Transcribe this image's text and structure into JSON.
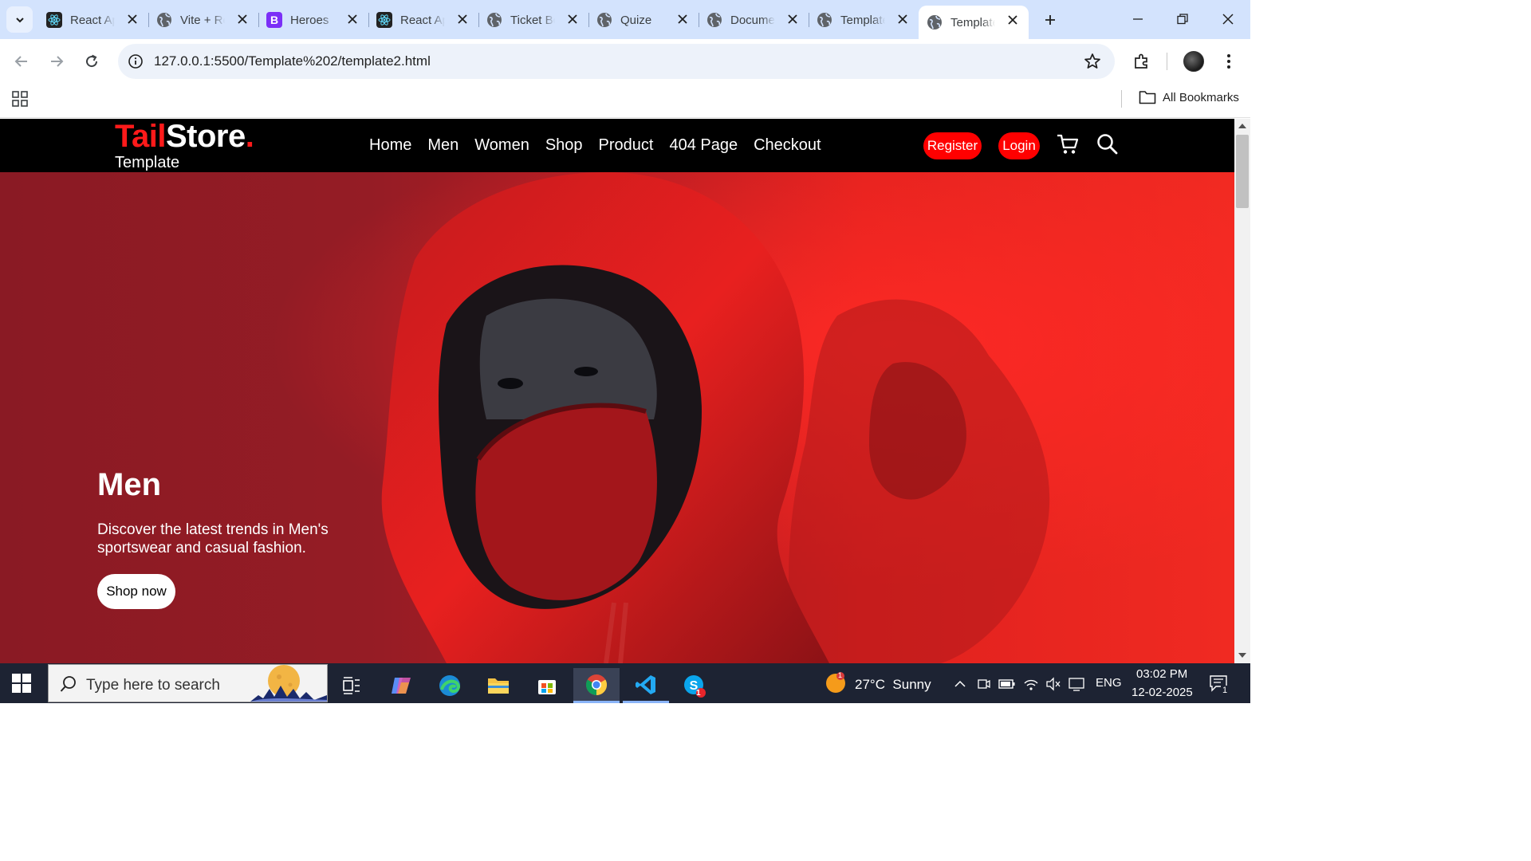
{
  "browser": {
    "tabs": [
      {
        "title": "React App",
        "favicon": "react-icon"
      },
      {
        "title": "Vite + React",
        "favicon": "globe-icon"
      },
      {
        "title": "Heroes",
        "favicon": "bootstrap-icon"
      },
      {
        "title": "React App",
        "favicon": "react-icon"
      },
      {
        "title": "Ticket Booking",
        "favicon": "globe-icon"
      },
      {
        "title": "Quize",
        "favicon": "globe-icon"
      },
      {
        "title": "Document",
        "favicon": "globe-icon"
      },
      {
        "title": "Template",
        "favicon": "globe-icon"
      },
      {
        "title": "Template",
        "favicon": "globe-icon",
        "active": true
      }
    ],
    "url": "127.0.0.1:5500/Template%202/template2.html",
    "bookmarks_label": "All Bookmarks"
  },
  "site": {
    "logo": {
      "part1": "Tail",
      "part2": "Store",
      "part3": ".",
      "subtitle": "Template"
    },
    "menu": [
      "Home",
      "Men",
      "Women",
      "Shop",
      "Product",
      "404 Page",
      "Checkout"
    ],
    "register_label": "Register",
    "login_label": "Login",
    "hero": {
      "heading": "Men",
      "text": "Discover the latest trends in Men's sportswear and casual fashion.",
      "button": "Shop now"
    }
  },
  "taskbar": {
    "search_placeholder": "Type here to search",
    "weather": "27°C  Sunny",
    "weather_badge": "1",
    "lang": "ENG",
    "time": "03:02 PM",
    "date": "12-02-2025",
    "notif_count": "1",
    "skype_badge": "1"
  },
  "colors": {
    "accent": "#ff0000",
    "tabstrip": "#d3e3fd",
    "hero_dark": "#8a1a24",
    "hero_bright": "#f02a22"
  }
}
